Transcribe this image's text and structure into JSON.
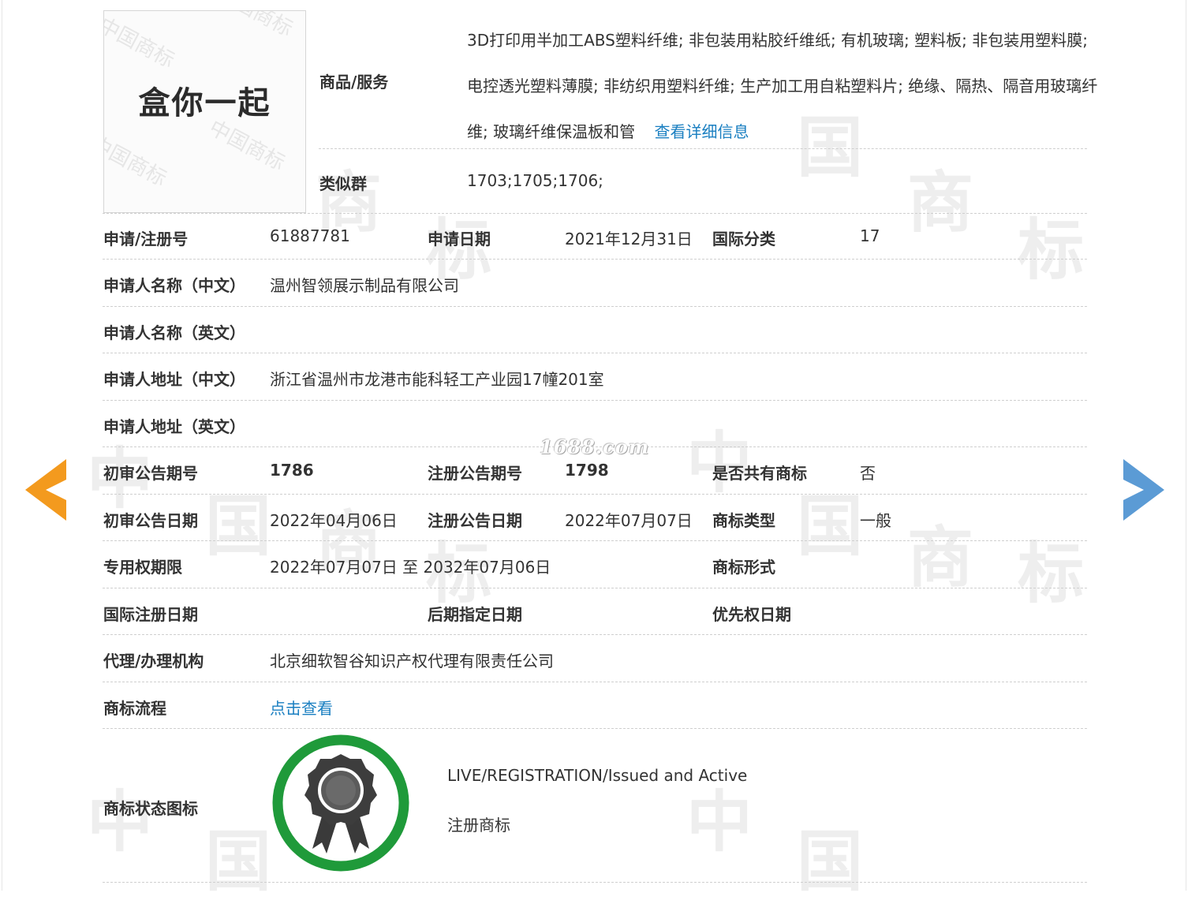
{
  "logo": {
    "text": "盒你一起",
    "watermark": "中国商标"
  },
  "site_watermark": "1688.com",
  "background_watermark": [
    "中",
    "国",
    "商",
    "标"
  ],
  "goods": {
    "label": "商品/服务",
    "text": "3D打印用半加工ABS塑料纤维; 非包装用粘胶纤维纸; 有机玻璃; 塑料板; 非包装用塑料膜; 电控透光塑料薄膜; 非纺织用塑料纤维; 生产加工用自粘塑料片; 绝缘、隔热、隔音用玻璃纤维; 玻璃纤维保温板和管",
    "detail_link": "查看详细信息"
  },
  "similar_group": {
    "label": "类似群",
    "value": "1703;1705;1706;"
  },
  "rows": {
    "reg_no_label": "申请/注册号",
    "reg_no": "61887781",
    "apply_date_label": "申请日期",
    "apply_date": "2021年12月31日",
    "intl_class_label": "国际分类",
    "intl_class": "17",
    "applicant_cn_label": "申请人名称（中文）",
    "applicant_cn": "温州智领展示制品有限公司",
    "applicant_en_label": "申请人名称（英文）",
    "address_cn_label": "申请人地址（中文）",
    "address_cn": "浙江省温州市龙港市能科轻工产业园17幢201室",
    "address_en_label": "申请人地址（英文）",
    "prelim_no_label": "初审公告期号",
    "prelim_no": "1786",
    "reg_pub_no_label": "注册公告期号",
    "reg_pub_no": "1798",
    "shared_label": "是否共有商标",
    "shared": "否",
    "prelim_date_label": "初审公告日期",
    "prelim_date": "2022年04月06日",
    "reg_pub_date_label": "注册公告日期",
    "reg_pub_date": "2022年07月07日",
    "tm_type_label": "商标类型",
    "tm_type": "一般",
    "exclusive_label": "专用权期限",
    "exclusive": "2022年07月07日 至 2032年07月06日",
    "tm_form_label": "商标形式",
    "intl_reg_date_label": "国际注册日期",
    "later_date_label": "后期指定日期",
    "priority_date_label": "优先权日期",
    "agency_label": "代理/办理机构",
    "agency": "北京细软智谷知识产权代理有限责任公司",
    "process_label": "商标流程",
    "process_link": "点击查看",
    "status_icon_label": "商标状态图标",
    "status_en": "LIVE/REGISTRATION/Issued and Active",
    "status_cn": "注册商标"
  },
  "colors": {
    "prev_arrow": "#f39a1e",
    "next_arrow": "#5b9bd5",
    "badge_ring": "#1f9a3a",
    "link": "#1a7fc1"
  },
  "icons": {
    "prev": "chevron-left-icon",
    "next": "chevron-right-icon",
    "status": "award-ribbon-icon"
  }
}
